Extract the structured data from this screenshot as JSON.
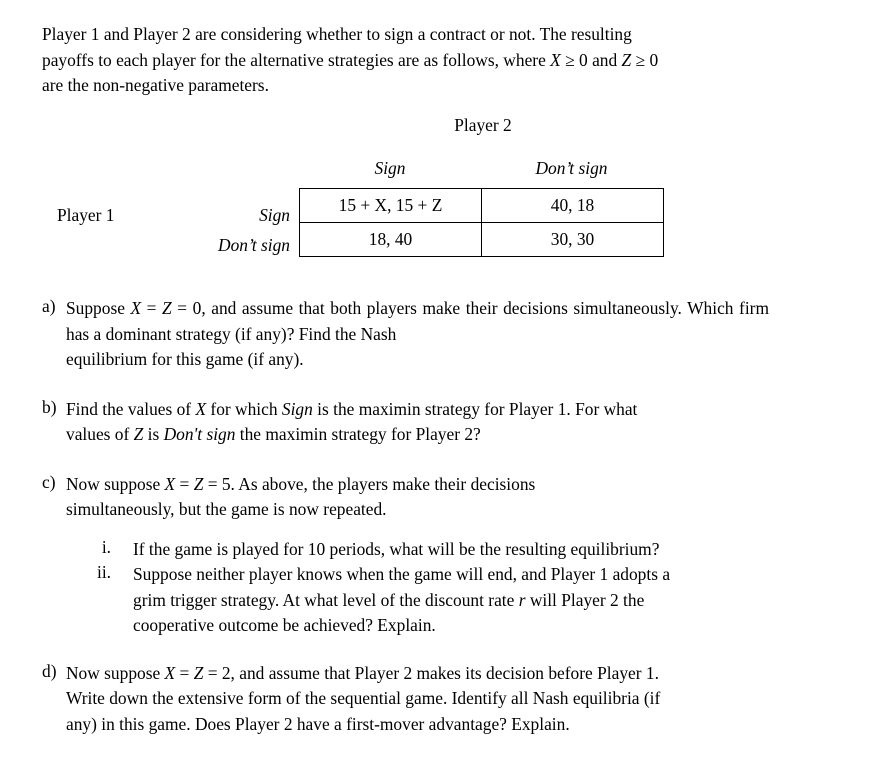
{
  "document": {
    "intro": {
      "line1": "Player 1 and Player 2 are considering whether to sign a contract or not. The resulting",
      "line2_pre": "payoffs to each player for the alternative strategies are as follows, where ",
      "line2_var1": "X",
      "line2_mid1": " ≥ 0 and ",
      "line2_var2": "Z",
      "line2_mid2": " ≥ 0",
      "line3": "are the non-negative parameters."
    },
    "matrix": {
      "player2_label": "Player 2",
      "player1_label": "Player 1",
      "column_headers": [
        "Sign",
        "Don’t sign"
      ],
      "row_headers": [
        "Sign",
        "Don’t sign"
      ],
      "cells": [
        [
          "15 + X, 15 + Z",
          "40, 18"
        ],
        [
          "18, 40",
          "30, 30"
        ]
      ]
    },
    "questions": [
      {
        "marker": "a)",
        "text_part1": "Suppose  ",
        "var1": "X",
        "text_part2": " = ",
        "var2": "Z",
        "text_part3": " = 0,  and  assume  that  both  players  make  their  decisions simultaneously. Which firm has a dominant strategy (if any)? Find the Nash",
        "text_last": "equilibrium for this game (if any)."
      },
      {
        "marker": "b)",
        "text_part1": "Find the values of ",
        "var1": "X",
        "text_part2": " for which ",
        "em1": "Sign",
        "text_part3": " is the maximin strategy for Player 1. For what",
        "text_last_pre": "values of ",
        "var2": "Z",
        "text_last_mid": " is ",
        "em2": "Don't sign",
        "text_last_post": " the maximin strategy for Player 2?"
      },
      {
        "marker": "c)",
        "text_part1": "Now  suppose  ",
        "var1": "X",
        "text_part2": "  =  ",
        "var2": "Z",
        "text_part3": "  =  5.  As  above,  the  players  make  their  decisions",
        "text_last": "simultaneously, but the game is now repeated.",
        "subitems": [
          {
            "marker": "i.",
            "text": "If the game is played for 10 periods, what will be the resulting equilibrium?"
          },
          {
            "marker": "ii.",
            "text_line1": "Suppose neither player knows when the game will end, and Player 1 adopts a",
            "text_line2_pre": "grim trigger strategy. At what level of the discount rate ",
            "var1": "r",
            "text_line2_post": " will Player 2 the",
            "text_line3": "cooperative outcome be achieved? Explain."
          }
        ]
      },
      {
        "marker": "d)",
        "text_part1": "Now suppose ",
        "var1": "X",
        "text_part2": " = ",
        "var2": "Z",
        "text_part3": " = 2, and assume that Player 2 makes its decision before Player 1.",
        "text_line2": "Write down the extensive form of the sequential game. Identify all Nash equilibria (if",
        "text_last": "any) in this game. Does Player 2 have a first-mover advantage? Explain."
      }
    ]
  }
}
